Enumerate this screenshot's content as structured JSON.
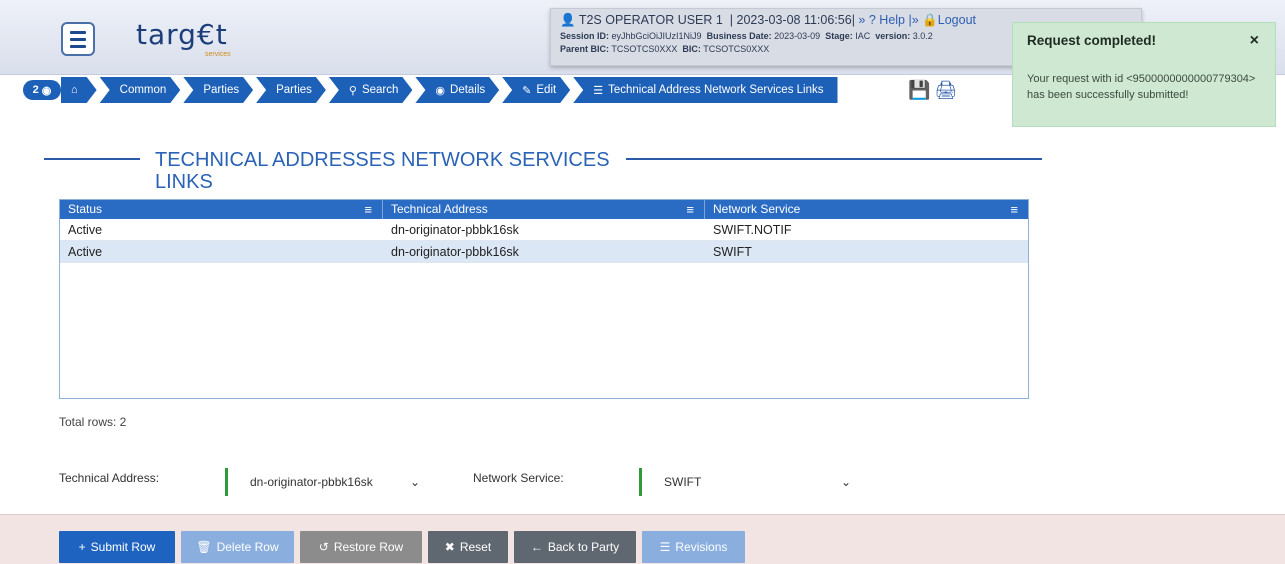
{
  "header": {
    "logo_text": "targ€t",
    "logo_sub": "services",
    "user": {
      "user_name": "T2S OPERATOR USER 1",
      "datetime": "2023-03-08 11:06:56",
      "help_label": "Help",
      "logout_label": "Logout",
      "session_label": "Session ID:",
      "session_value": "eyJhbGciOiJIUzI1NiJ9",
      "business_date_label": "Business Date:",
      "business_date_value": "2023-03-09",
      "stage_label": "Stage:",
      "stage_value": "IAC",
      "version_label": "version:",
      "version_value": "3.0.2",
      "parent_bic_label": "Parent BIC:",
      "parent_bic_value": "TCSOTCS0XXX",
      "bic_label": "BIC:",
      "bic_value": "TCSOTCS0XXX"
    }
  },
  "toast": {
    "title": "Request completed!",
    "close": "×",
    "message": "Your request with id <9500000000000779304> has been successfully submitted!"
  },
  "breadcrumb": {
    "badge": "2",
    "items": [
      {
        "icon": "home-icon",
        "label": ""
      },
      {
        "label": "Common"
      },
      {
        "label": "Parties"
      },
      {
        "label": "Parties"
      },
      {
        "icon": "search-icon",
        "label": "Search"
      },
      {
        "icon": "eye-icon",
        "label": "Details"
      },
      {
        "icon": "edit-icon",
        "label": "Edit"
      },
      {
        "icon": "list-icon",
        "label": "Technical Address Network Services Links"
      }
    ]
  },
  "section_title": "TECHNICAL ADDRESSES NETWORK SERVICES LINKS",
  "table": {
    "columns": [
      "Status",
      "Technical Address",
      "Network Service"
    ],
    "rows": [
      [
        "Active",
        "dn-originator-pbbk16sk",
        "SWIFT.NOTIF"
      ],
      [
        "Active",
        "dn-originator-pbbk16sk",
        "SWIFT"
      ]
    ],
    "total_rows": "Total rows: 2"
  },
  "form": {
    "technical_address_label": "Technical Address:",
    "technical_address_value": "dn-originator-pbbk16sk",
    "network_service_label": "Network Service:",
    "network_service_value": "SWIFT"
  },
  "buttons": {
    "submit_row": "Submit Row",
    "delete_row": "Delete Row",
    "restore_row": "Restore Row",
    "reset": "Reset",
    "back_to_party": "Back to Party",
    "revisions": "Revisions"
  }
}
